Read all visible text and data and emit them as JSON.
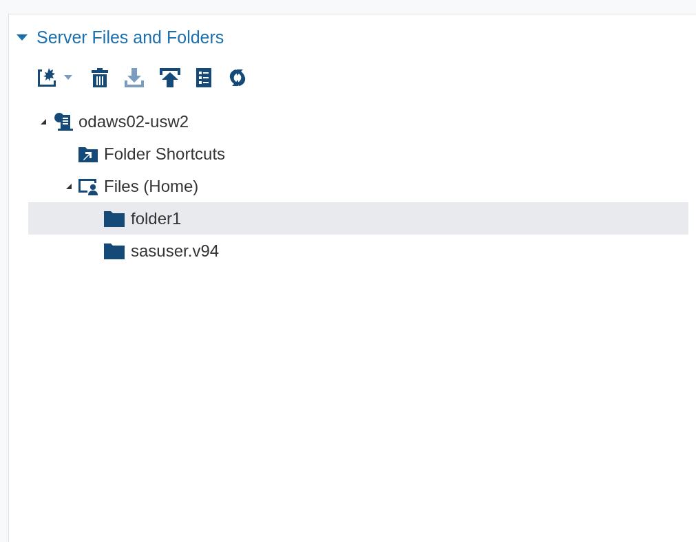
{
  "panel": {
    "title": "Server Files and Folders",
    "expanded": true
  },
  "toolbar": [
    {
      "kind": "new",
      "disabled": false
    },
    {
      "kind": "delete",
      "disabled": false
    },
    {
      "kind": "download",
      "disabled": true
    },
    {
      "kind": "upload",
      "disabled": false
    },
    {
      "kind": "properties",
      "disabled": false
    },
    {
      "kind": "refresh",
      "disabled": false
    }
  ],
  "tree": [
    {
      "label": "odaws02-usw2",
      "kind": "server",
      "expanded": true,
      "selected": false,
      "children": [
        {
          "label": "Folder Shortcuts",
          "kind": "shortcuts",
          "selected": false
        },
        {
          "label": "Files (Home)",
          "kind": "home",
          "expanded": true,
          "selected": false,
          "children": [
            {
              "label": "folder1",
              "kind": "folder",
              "selected": true
            },
            {
              "label": "sasuser.v94",
              "kind": "folder",
              "selected": false
            }
          ]
        }
      ]
    }
  ]
}
